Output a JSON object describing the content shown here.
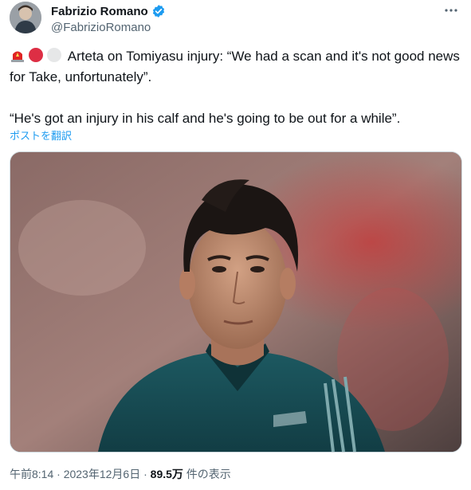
{
  "author": {
    "display_name": "Fabrizio Romano",
    "handle": "@FabrizioRomano"
  },
  "tweet": {
    "line1": " Arteta on Tomiyasu injury: “We had a scan and it's not good news for Take, unfortunately”.",
    "line2": "“He's got an injury in his calf and he's going to be out for a while”.",
    "translate_label": "ポストを翻訳"
  },
  "meta": {
    "time": "午前8:14",
    "sep1": " · ",
    "date": "2023年12月6日",
    "sep2": " · ",
    "views_count": "89.5万",
    "views_label": " 件の表示"
  },
  "colors": {
    "accent": "#1d9bf0",
    "muted": "#536471",
    "text": "#0f1419"
  },
  "icons": [
    "verified-badge-icon",
    "more-options-icon",
    "siren-icon",
    "red-circle-icon",
    "white-circle-icon"
  ]
}
